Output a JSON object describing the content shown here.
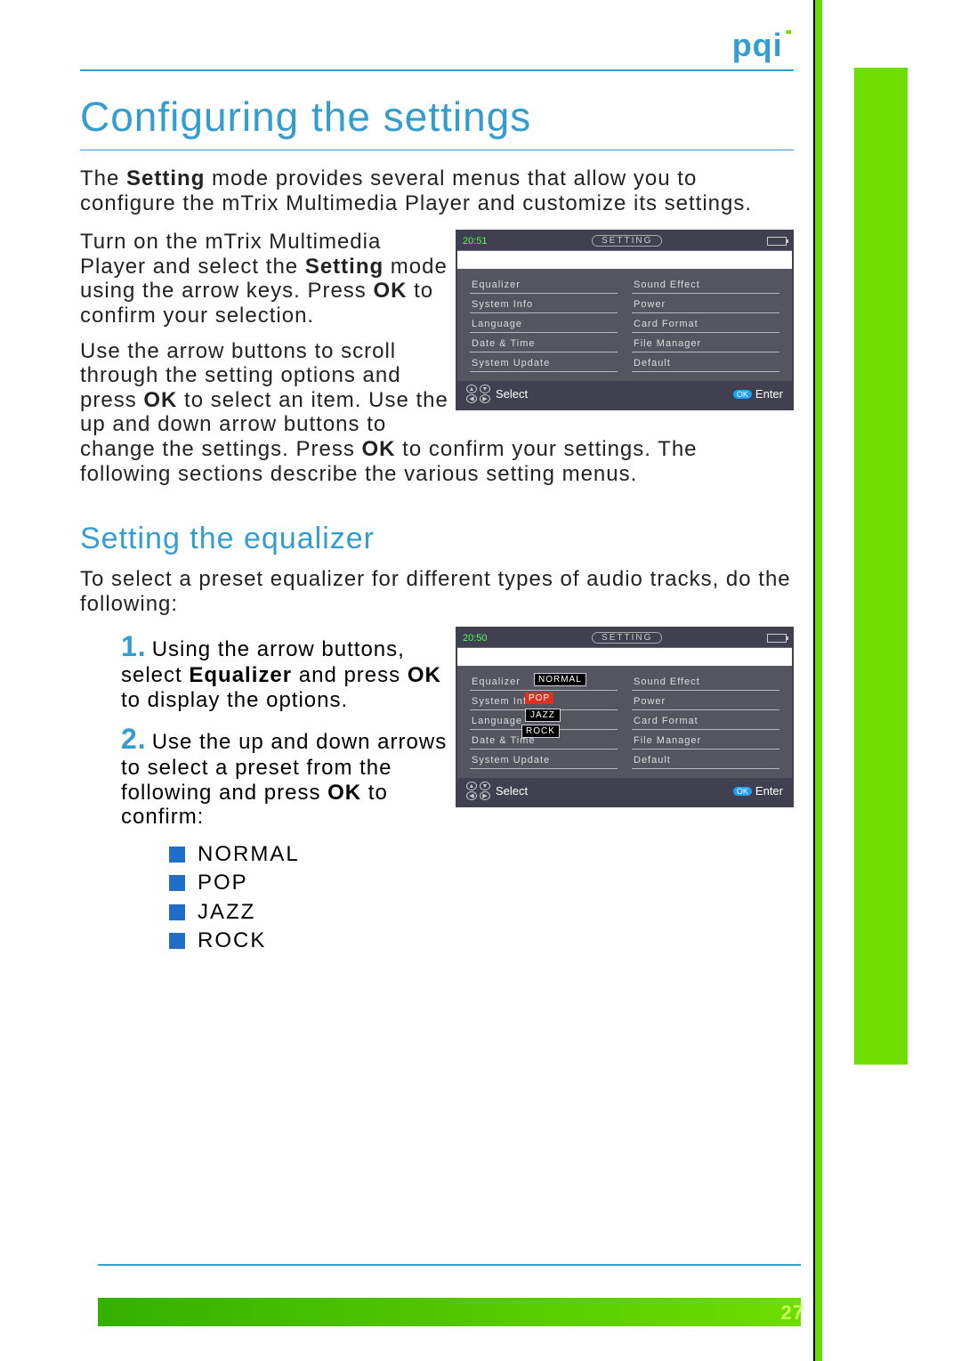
{
  "logo": {
    "text": "pqi"
  },
  "headings": {
    "main": "Configuring the settings",
    "sub": "Setting the equalizer"
  },
  "para1": {
    "pre": "The ",
    "bold1": "Setting",
    "post1": " mode provides several menus that allow you to configure the mTrix Multimedia Player and customize its settings."
  },
  "para2": {
    "a": "Turn on the mTrix Multimedia Player and select the ",
    "b": "Setting",
    "c": " mode using the arrow keys. Press ",
    "d": "OK",
    "e": " to confirm your selection."
  },
  "para3": {
    "a": "Use the arrow buttons to scroll through the setting options and press ",
    "b": "OK",
    "c": " to select an item. Use the up and down arrow buttons to change the settings. Press ",
    "d": "OK",
    "e": " to confirm your settings. The following sections describe the various setting menus."
  },
  "para4": "To select a preset equalizer for different types of audio tracks, do the following:",
  "step1": {
    "a": "Using the arrow buttons, select ",
    "b": "Equalizer",
    "c": " and press ",
    "d": "OK",
    "e": " to display the options."
  },
  "step2": {
    "a": "Use the up and down arrows to select a preset from the following and press ",
    "b": "OK",
    "c": " to confirm:"
  },
  "presets": [
    "NORMAL",
    "POP",
    "JAZZ",
    "ROCK"
  ],
  "device1": {
    "time": "20:51",
    "badge": "SETTING",
    "left": [
      "Equalizer",
      "System Info",
      "Language",
      "Date & Time",
      "System Update"
    ],
    "right": [
      "Sound Effect",
      "Power",
      "Card Format",
      "File Manager",
      "Default"
    ],
    "footer": {
      "select": "Select",
      "enter": "Enter",
      "ok": "OK"
    }
  },
  "device2": {
    "time": "20:50",
    "badge": "SETTING",
    "left": [
      "Equalizer",
      "System Info",
      "Language",
      "Date & Time",
      "System Update"
    ],
    "right": [
      "Sound Effect",
      "Power",
      "Card Format",
      "File Manager",
      "Default"
    ],
    "popup": [
      "NORMAL",
      "POP",
      "JAZZ",
      "ROCK"
    ],
    "footer": {
      "select": "Select",
      "enter": "Enter",
      "ok": "OK"
    }
  },
  "page_number": "27"
}
